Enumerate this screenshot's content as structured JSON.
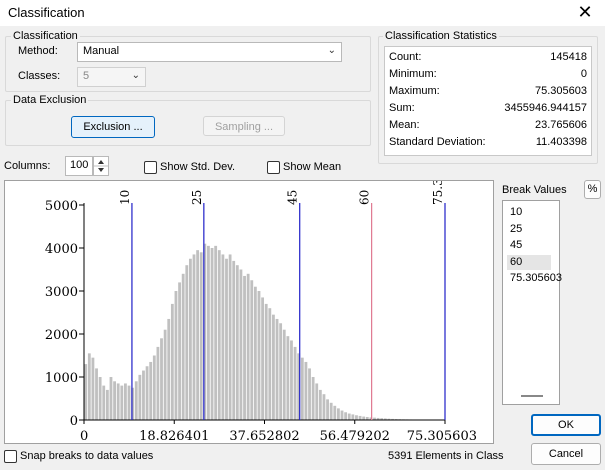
{
  "window": {
    "title": "Classification",
    "close_glyph": "✕"
  },
  "classification": {
    "group_label": "Classification",
    "method_label": "Method:",
    "method_value": "Manual",
    "classes_label": "Classes:",
    "classes_value": "5"
  },
  "exclusion": {
    "group_label": "Data Exclusion",
    "exclusion_button": "Exclusion ...",
    "sampling_button": "Sampling ..."
  },
  "statistics": {
    "group_label": "Classification Statistics",
    "rows": [
      {
        "key": "Count:",
        "value": "145418"
      },
      {
        "key": "Minimum:",
        "value": "0"
      },
      {
        "key": "Maximum:",
        "value": "75.305603"
      },
      {
        "key": "Sum:",
        "value": "3455946.944157"
      },
      {
        "key": "Mean:",
        "value": "23.765606"
      },
      {
        "key": "Standard Deviation:",
        "value": "11.403398"
      }
    ]
  },
  "options": {
    "columns_label": "Columns:",
    "columns_value": "100",
    "show_std_dev": "Show Std. Dev.",
    "show_mean": "Show Mean",
    "snap_breaks": "Snap breaks to data values",
    "elements_in_class": "5391 Elements in Class"
  },
  "break_values": {
    "label": "Break Values",
    "percent_button": "%",
    "items": [
      "10",
      "25",
      "45",
      "60",
      "75.305603"
    ],
    "selected_index": 3
  },
  "buttons": {
    "ok": "OK",
    "cancel": "Cancel"
  },
  "colors": {
    "bar": "#c0c0c0",
    "break_line": "#2020c8",
    "selected_break_line": "#e07890",
    "accent": "#0067c0"
  },
  "chart_data": {
    "type": "bar",
    "xlim": [
      0,
      75.305603
    ],
    "ylim": [
      0,
      5000
    ],
    "x_ticks": [
      "0",
      "18.826401",
      "37.652802",
      "56.479202",
      "75.305603"
    ],
    "y_ticks": [
      "0",
      "1000",
      "2000",
      "3000",
      "4000",
      "5000"
    ],
    "break_labels": [
      "10",
      "25",
      "45",
      "60",
      "75.305603"
    ],
    "breaks": [
      10,
      25,
      45,
      60,
      75.305603
    ],
    "selected_break_index": 3,
    "bin_count": 100,
    "values": [
      1300,
      1550,
      1450,
      1200,
      1000,
      800,
      700,
      1000,
      900,
      850,
      800,
      850,
      800,
      750,
      900,
      1050,
      1150,
      1250,
      1350,
      1500,
      1700,
      1900,
      2100,
      2350,
      2700,
      3000,
      3200,
      3400,
      3600,
      3750,
      3850,
      3950,
      3900,
      4100,
      4050,
      4000,
      4050,
      3950,
      3850,
      3750,
      3850,
      3700,
      3600,
      3500,
      3350,
      3400,
      3250,
      3100,
      3000,
      2850,
      2700,
      2600,
      2450,
      2350,
      2250,
      2100,
      1950,
      1850,
      1700,
      1550,
      1450,
      1350,
      1200,
      1000,
      850,
      700,
      600,
      480,
      400,
      330,
      270,
      220,
      180,
      150,
      130,
      110,
      95,
      80,
      70,
      60,
      55,
      48,
      42,
      36,
      30,
      26,
      22,
      19,
      16,
      14,
      12,
      10,
      9,
      8,
      7,
      6,
      5,
      4,
      3,
      2
    ]
  }
}
